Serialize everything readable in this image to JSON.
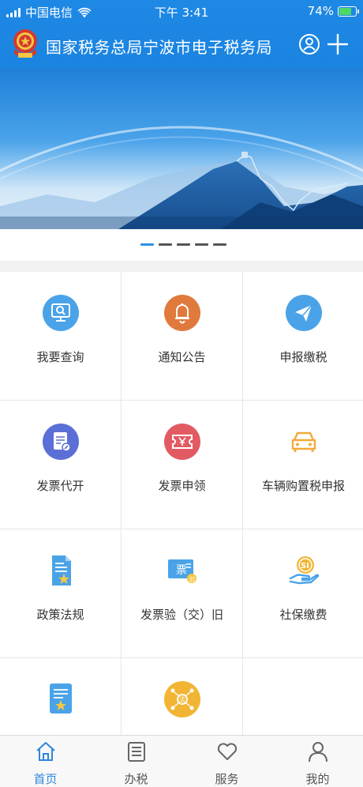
{
  "status_bar": {
    "carrier": "中国电信",
    "time": "下午 3:41",
    "battery_percent": "74%",
    "battery_level": 0.74
  },
  "header": {
    "title": "国家税务总局宁波市电子税务局",
    "emblem_icon": "tax-emblem-icon",
    "user_icon": "user-circle-icon",
    "add_icon": "plus-icon"
  },
  "banner": {
    "slide_count": 5,
    "active_slide": 1
  },
  "grid": {
    "items": [
      {
        "label": "我要查询",
        "icon": "monitor-search-icon",
        "color": "#4aa3e8"
      },
      {
        "label": "通知公告",
        "icon": "bell-icon",
        "color": "#e07a3c"
      },
      {
        "label": "申报缴税",
        "icon": "paper-plane-icon",
        "color": "#4aa3e8"
      },
      {
        "label": "发票代开",
        "icon": "invoice-edit-icon",
        "color": "#5b6fd6"
      },
      {
        "label": "发票申领",
        "icon": "ticket-yen-icon",
        "color": "#e25b63"
      },
      {
        "label": "车辆购置税申报",
        "icon": "car-icon",
        "color": "#f2a93b"
      },
      {
        "label": "政策法规",
        "icon": "document-star-icon",
        "color": "#4aa3e8"
      },
      {
        "label": "发票验（交）旧",
        "icon": "invoice-ticket-icon",
        "color": "#4aa3e8"
      },
      {
        "label": "社保缴费",
        "icon": "social-security-hand-icon",
        "color": "#f2b533"
      },
      {
        "label": "",
        "icon": "certificate-star-icon",
        "color": "#4aa3e8"
      },
      {
        "label": "",
        "icon": "law-network-icon",
        "color": "#f2b533"
      },
      {
        "label": "",
        "icon": "",
        "color": ""
      }
    ]
  },
  "tabbar": {
    "items": [
      {
        "label": "首页",
        "icon": "home-icon",
        "active": true
      },
      {
        "label": "办税",
        "icon": "list-icon",
        "active": false
      },
      {
        "label": "服务",
        "icon": "heart-icon",
        "active": false
      },
      {
        "label": "我的",
        "icon": "person-icon",
        "active": false
      }
    ]
  },
  "colors": {
    "brand_blue": "#1e88e5",
    "tab_active": "#2e86de"
  }
}
